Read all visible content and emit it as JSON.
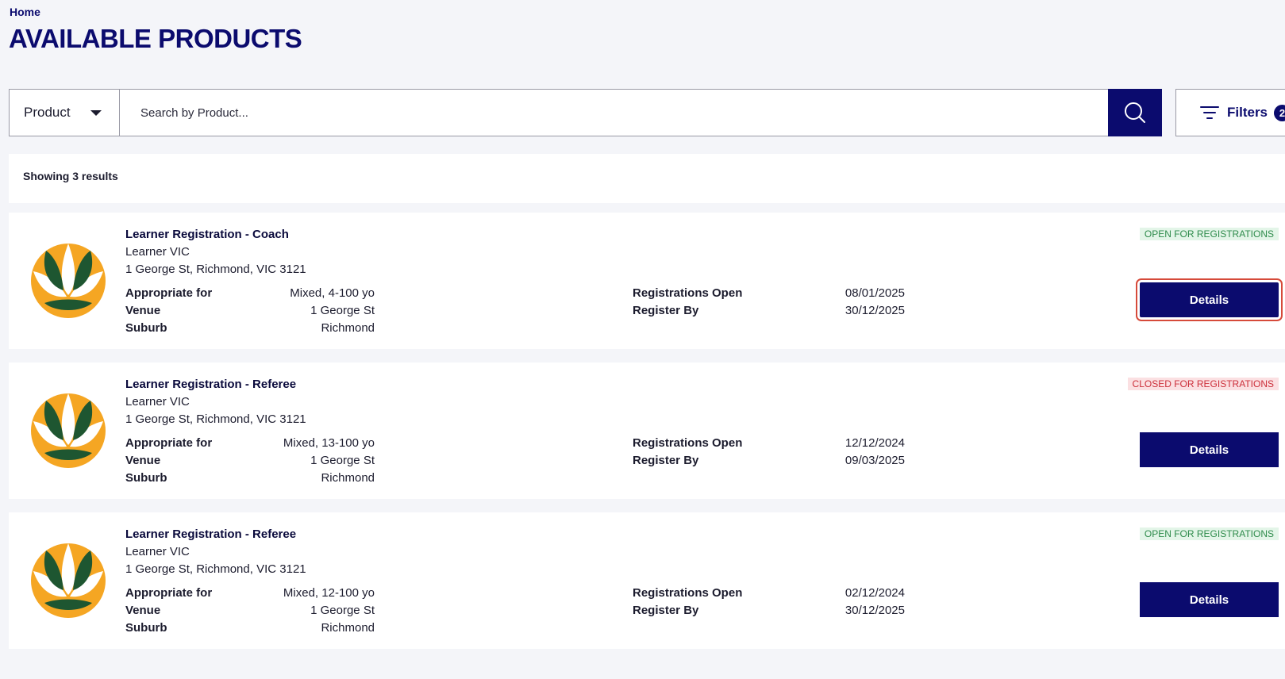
{
  "breadcrumb": "Home",
  "page_title": "AVAILABLE PRODUCTS",
  "search": {
    "type_select": "Product",
    "placeholder": "Search by Product..."
  },
  "filters": {
    "label": "Filters",
    "count": "2"
  },
  "results_text": "Showing 3 results",
  "labels": {
    "appropriate_for": "Appropriate for",
    "venue": "Venue",
    "suburb": "Suburb",
    "registrations_open": "Registrations Open",
    "register_by": "Register By",
    "details": "Details"
  },
  "products": [
    {
      "name": "Learner Registration - Coach",
      "org": "Learner VIC",
      "address": "1 George St, Richmond, VIC 3121",
      "appropriate_for": "Mixed, 4-100 yo",
      "venue": "1 George St",
      "suburb": "Richmond",
      "registrations_open": "08/01/2025",
      "register_by": "30/12/2025",
      "status": "OPEN FOR REGISTRATIONS"
    },
    {
      "name": "Learner Registration - Referee",
      "org": "Learner VIC",
      "address": "1 George St, Richmond, VIC 3121",
      "appropriate_for": "Mixed, 13-100 yo",
      "venue": "1 George St",
      "suburb": "Richmond",
      "registrations_open": "12/12/2024",
      "register_by": "09/03/2025",
      "status": "CLOSED FOR REGISTRATIONS"
    },
    {
      "name": "Learner Registration - Referee",
      "org": "Learner VIC",
      "address": "1 George St, Richmond, VIC 3121",
      "appropriate_for": "Mixed, 12-100 yo",
      "venue": "1 George St",
      "suburb": "Richmond",
      "registrations_open": "02/12/2024",
      "register_by": "30/12/2025",
      "status": "OPEN FOR REGISTRATIONS"
    }
  ],
  "colors": {
    "brand_navy": "#0b0b6e",
    "logo_green": "#1e5631",
    "logo_yellow": "#f5a623",
    "open_green": "#2e8b4b",
    "closed_red": "#cc2f3a",
    "focus_ring": "#d64a3a"
  },
  "icons": {
    "search": "search-icon",
    "filters": "filter-lines-icon",
    "caret": "chevron-down-icon",
    "product_logo": "football-australia-logo"
  }
}
